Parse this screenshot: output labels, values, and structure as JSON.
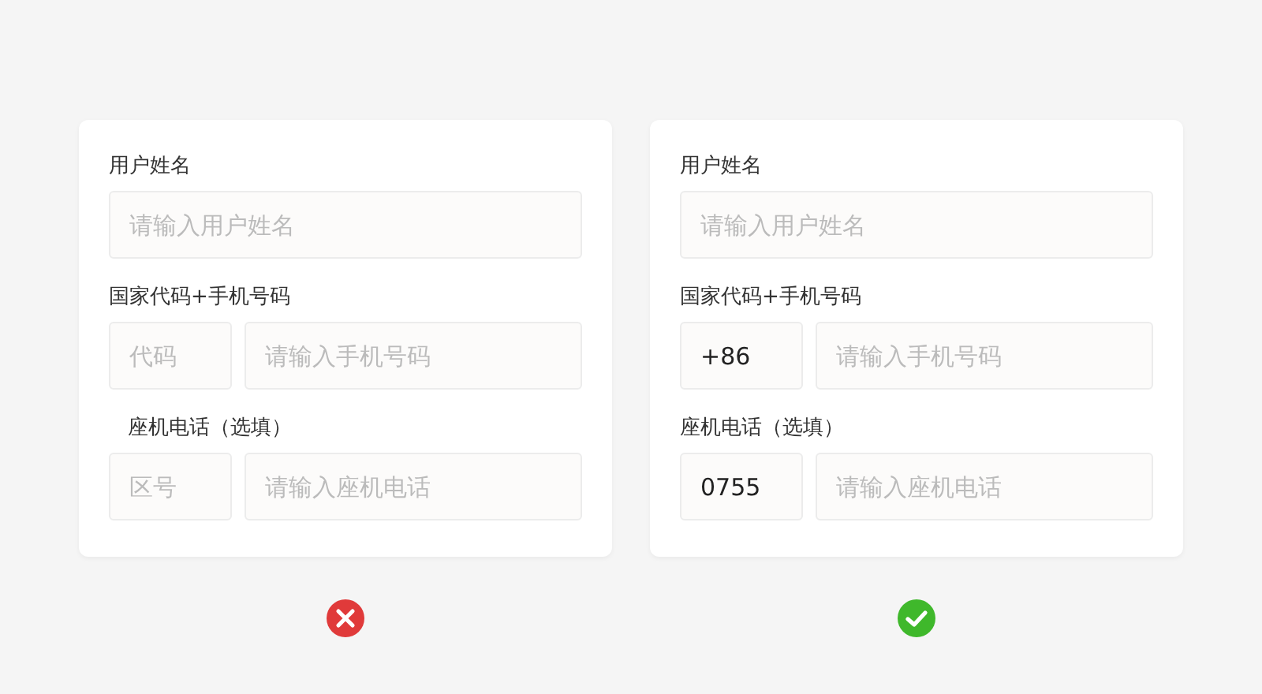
{
  "examples": [
    {
      "kind": "wrong",
      "fields": [
        {
          "label": "用户姓名",
          "label_indented": false,
          "inputs": [
            {
              "placeholder": "请输入用户姓名"
            }
          ]
        },
        {
          "label": "国家代码+手机号码",
          "label_indented": false,
          "inputs": [
            {
              "placeholder": "代码"
            },
            {
              "placeholder": "请输入手机号码"
            }
          ]
        },
        {
          "label": "座机电话（选填）",
          "label_indented": true,
          "inputs": [
            {
              "placeholder": "区号"
            },
            {
              "placeholder": "请输入座机电话"
            }
          ]
        }
      ]
    },
    {
      "kind": "right",
      "fields": [
        {
          "label": "用户姓名",
          "label_indented": false,
          "inputs": [
            {
              "placeholder": "请输入用户姓名"
            }
          ]
        },
        {
          "label": "国家代码+手机号码",
          "label_indented": false,
          "inputs": [
            {
              "value": "+86"
            },
            {
              "placeholder": "请输入手机号码"
            }
          ]
        },
        {
          "label": "座机电话（选填）",
          "label_indented": false,
          "inputs": [
            {
              "value": "0755"
            },
            {
              "placeholder": "请输入座机电话"
            }
          ]
        }
      ]
    }
  ]
}
